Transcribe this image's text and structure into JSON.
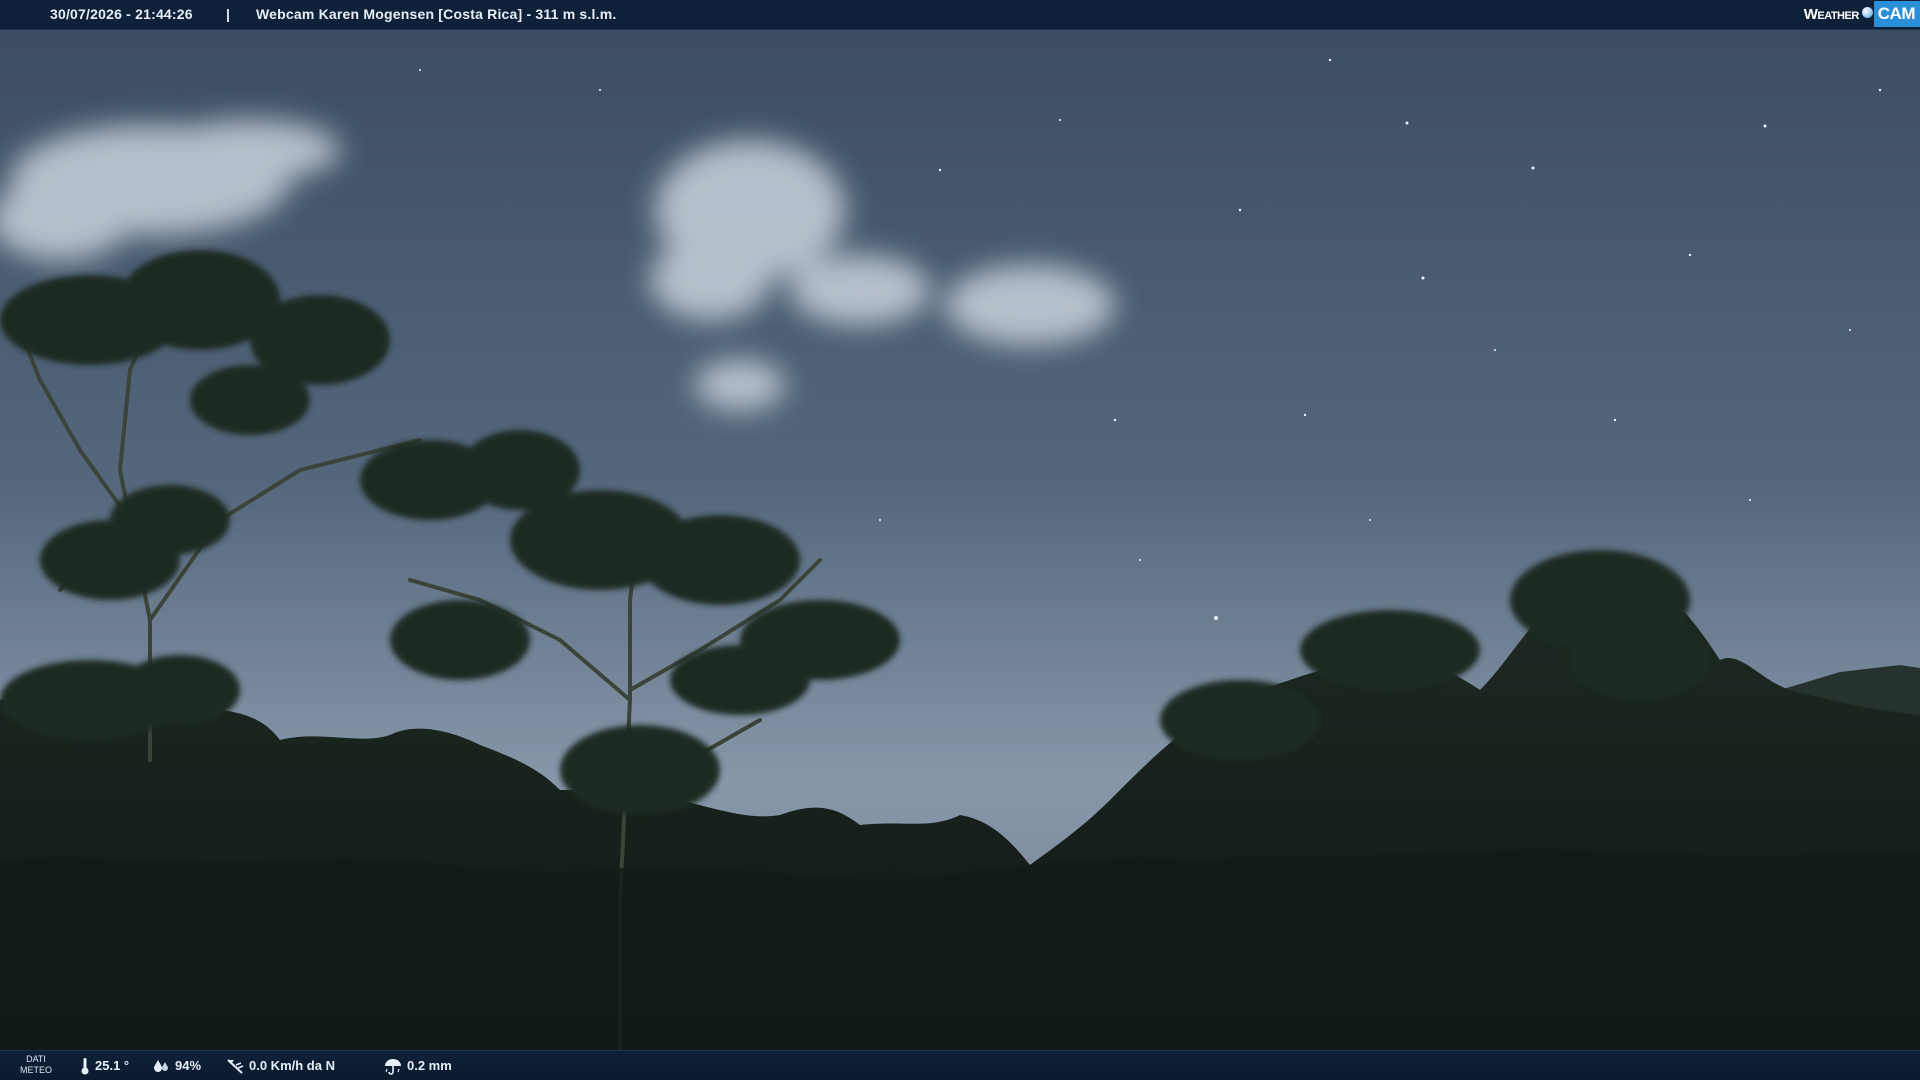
{
  "overlay": {
    "datetime": "30/07/2026 - 21:44:26",
    "separator": "|",
    "title": "Webcam Karen Mogensen [Costa Rica]  - 311 m s.l.m.",
    "brand": {
      "weather": "Weather",
      "cam": "CAM"
    }
  },
  "meteo": {
    "label_line1": "DATI",
    "label_line2": "METEO",
    "temperature": "25.1 °",
    "humidity": "94%",
    "wind": "0.0 Km/h da N",
    "rain": "0.2 mm"
  },
  "icons": {
    "temperature": "thermometer-icon",
    "humidity": "water-drops-icon",
    "wind": "wind-vane-icon",
    "rain": "rain-umbrella-icon"
  },
  "colors": {
    "bar_background": "#0f2138",
    "brand_accent": "#2a8fd8",
    "sky_top": "#3e5066",
    "sky_horizon": "#8a9bad",
    "foliage": "#162018"
  }
}
